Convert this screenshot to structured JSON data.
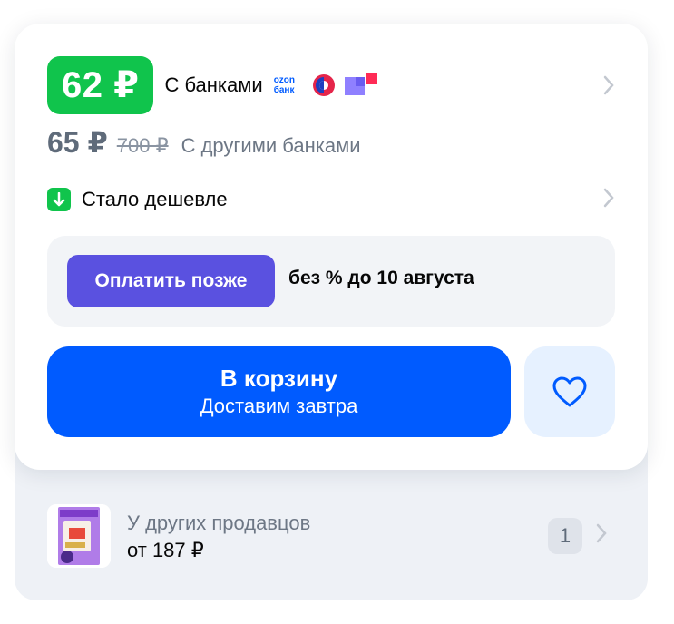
{
  "main_price": {
    "value": "62 ₽",
    "label": "С банками",
    "ozon_bank_line1": "ozon",
    "ozon_bank_line2": "банк"
  },
  "other_price": {
    "value": "65 ₽",
    "old": "700 ₽",
    "label": "С другими банками"
  },
  "cheaper": {
    "label": "Стало дешевле"
  },
  "pay_later": {
    "button": "Оплатить позже",
    "text": "без % до 10 августа"
  },
  "cart": {
    "title": "В корзину",
    "subtitle": "Доставим завтра"
  },
  "other_sellers": {
    "label": "У других продавцов",
    "price": "от 187 ₽",
    "count": "1"
  },
  "colors": {
    "green": "#10c44c",
    "blue": "#005bff",
    "violet": "#5a51e0",
    "fav_bg": "#e6f1ff"
  },
  "icons": [
    "ozon-bank-logo",
    "sbp-icon",
    "violet-bank-icon",
    "arrow-down-icon",
    "chevron-right-icon",
    "heart-icon"
  ]
}
